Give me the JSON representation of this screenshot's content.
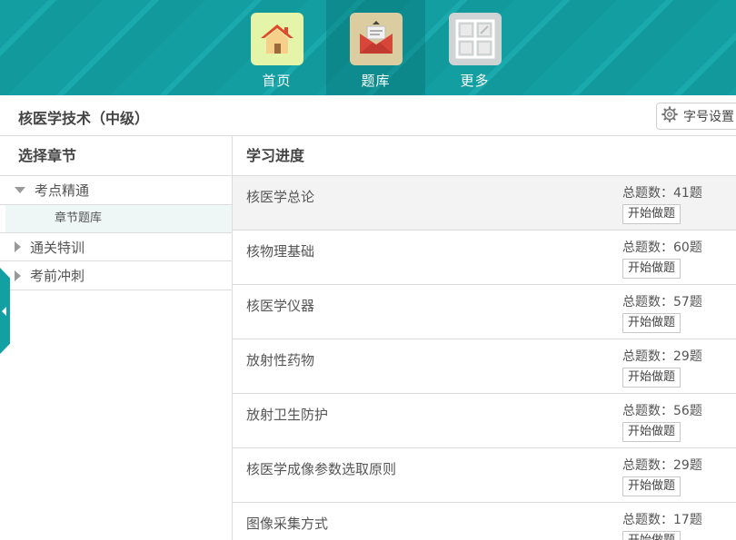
{
  "nav": [
    {
      "label": "首页",
      "icon": "home-icon"
    },
    {
      "label": "题库",
      "icon": "mailbox-icon"
    },
    {
      "label": "更多",
      "icon": "grid-icon"
    }
  ],
  "header": {
    "title": "核医学技术（中级）",
    "font_setting_label": "字号设置"
  },
  "sidebar": {
    "heading": "选择章节",
    "items": [
      {
        "label": "考点精通",
        "expanded": true
      },
      {
        "label": "章节题库"
      },
      {
        "label": "通关特训",
        "expanded": false
      },
      {
        "label": "考前冲刺",
        "expanded": false
      }
    ]
  },
  "main": {
    "heading": "学习进度",
    "start_label": "开始做题",
    "chapters": [
      {
        "title": "核医学总论",
        "count": "总题数：41题"
      },
      {
        "title": "核物理基础",
        "count": "总题数：60题"
      },
      {
        "title": "核医学仪器",
        "count": "总题数：57题"
      },
      {
        "title": "放射性药物",
        "count": "总题数：29题"
      },
      {
        "title": "放射卫生防护",
        "count": "总题数：56题"
      },
      {
        "title": "核医学成像参数选取原则",
        "count": "总题数：29题"
      },
      {
        "title": "图像采集方式",
        "count": "总题数：17题"
      }
    ]
  },
  "colors": {
    "accent": "#139ea1",
    "home_tile": "#e4f4a8",
    "bank_tile": "#dccda0",
    "more_tile": "#cfd3d3"
  }
}
